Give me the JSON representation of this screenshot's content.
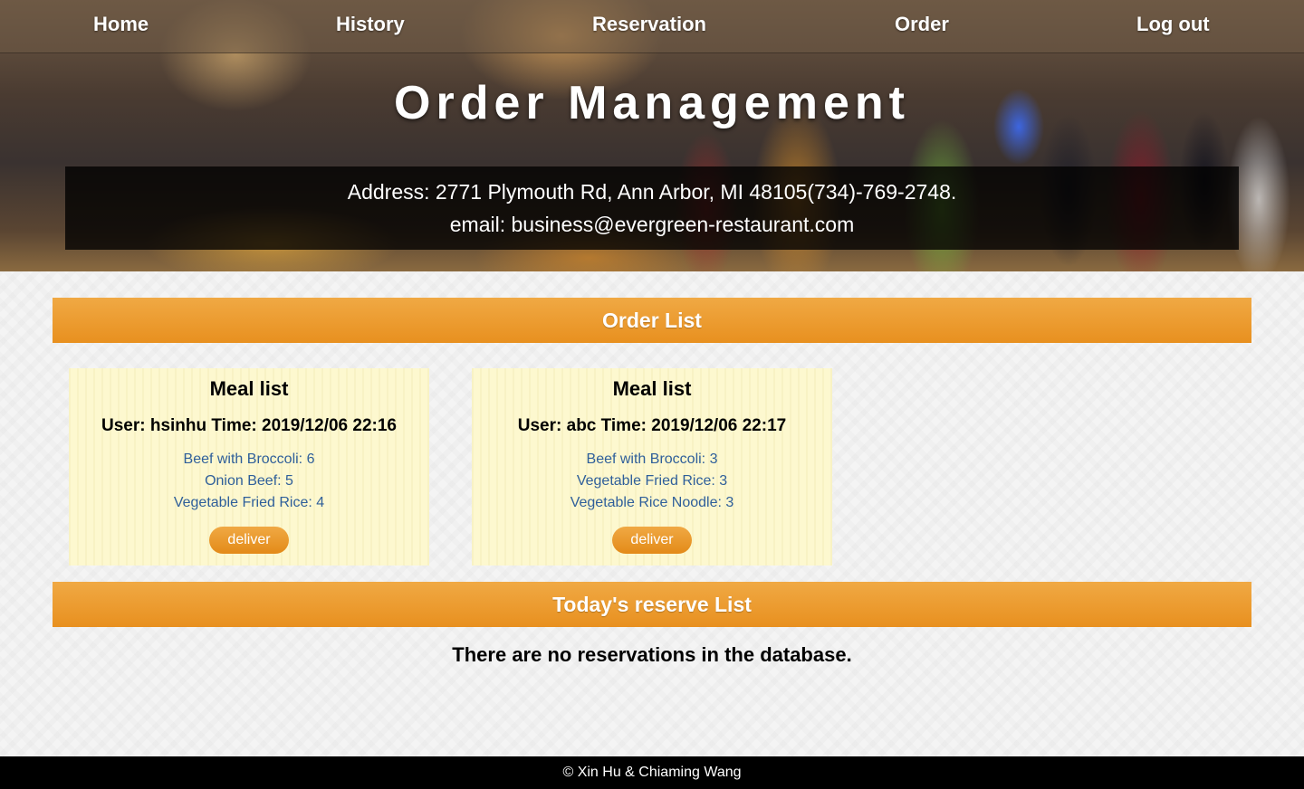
{
  "nav": {
    "home": "Home",
    "history": "History",
    "reservation": "Reservation",
    "order": "Order",
    "logout": "Log out"
  },
  "header": {
    "title": "Order Management",
    "address": "Address: 2771 Plymouth Rd, Ann Arbor, MI 48105(734)-769-2748.",
    "email": "email: business@evergreen-restaurant.com"
  },
  "order_section": {
    "title": "Order List",
    "orders": [
      {
        "title": "Meal list",
        "user_time": "User: hsinhu Time: 2019/12/06 22:16",
        "items": [
          "Beef with Broccoli: 6",
          "Onion Beef: 5",
          "Vegetable Fried Rice: 4"
        ],
        "button": "deliver"
      },
      {
        "title": "Meal list",
        "user_time": "User: abc Time: 2019/12/06 22:17",
        "items": [
          "Beef with Broccoli: 3",
          "Vegetable Fried Rice: 3",
          "Vegetable Rice Noodle: 3"
        ],
        "button": "deliver"
      }
    ]
  },
  "reserve_section": {
    "title": "Today's reserve List",
    "empty_message": "There are no reservations in the database."
  },
  "footer": {
    "text": "© Xin Hu & Chiaming Wang"
  },
  "colors": {
    "accent": "#e8901f",
    "card_bg": "#fdf8cf",
    "item_text": "#2f5f9a"
  }
}
